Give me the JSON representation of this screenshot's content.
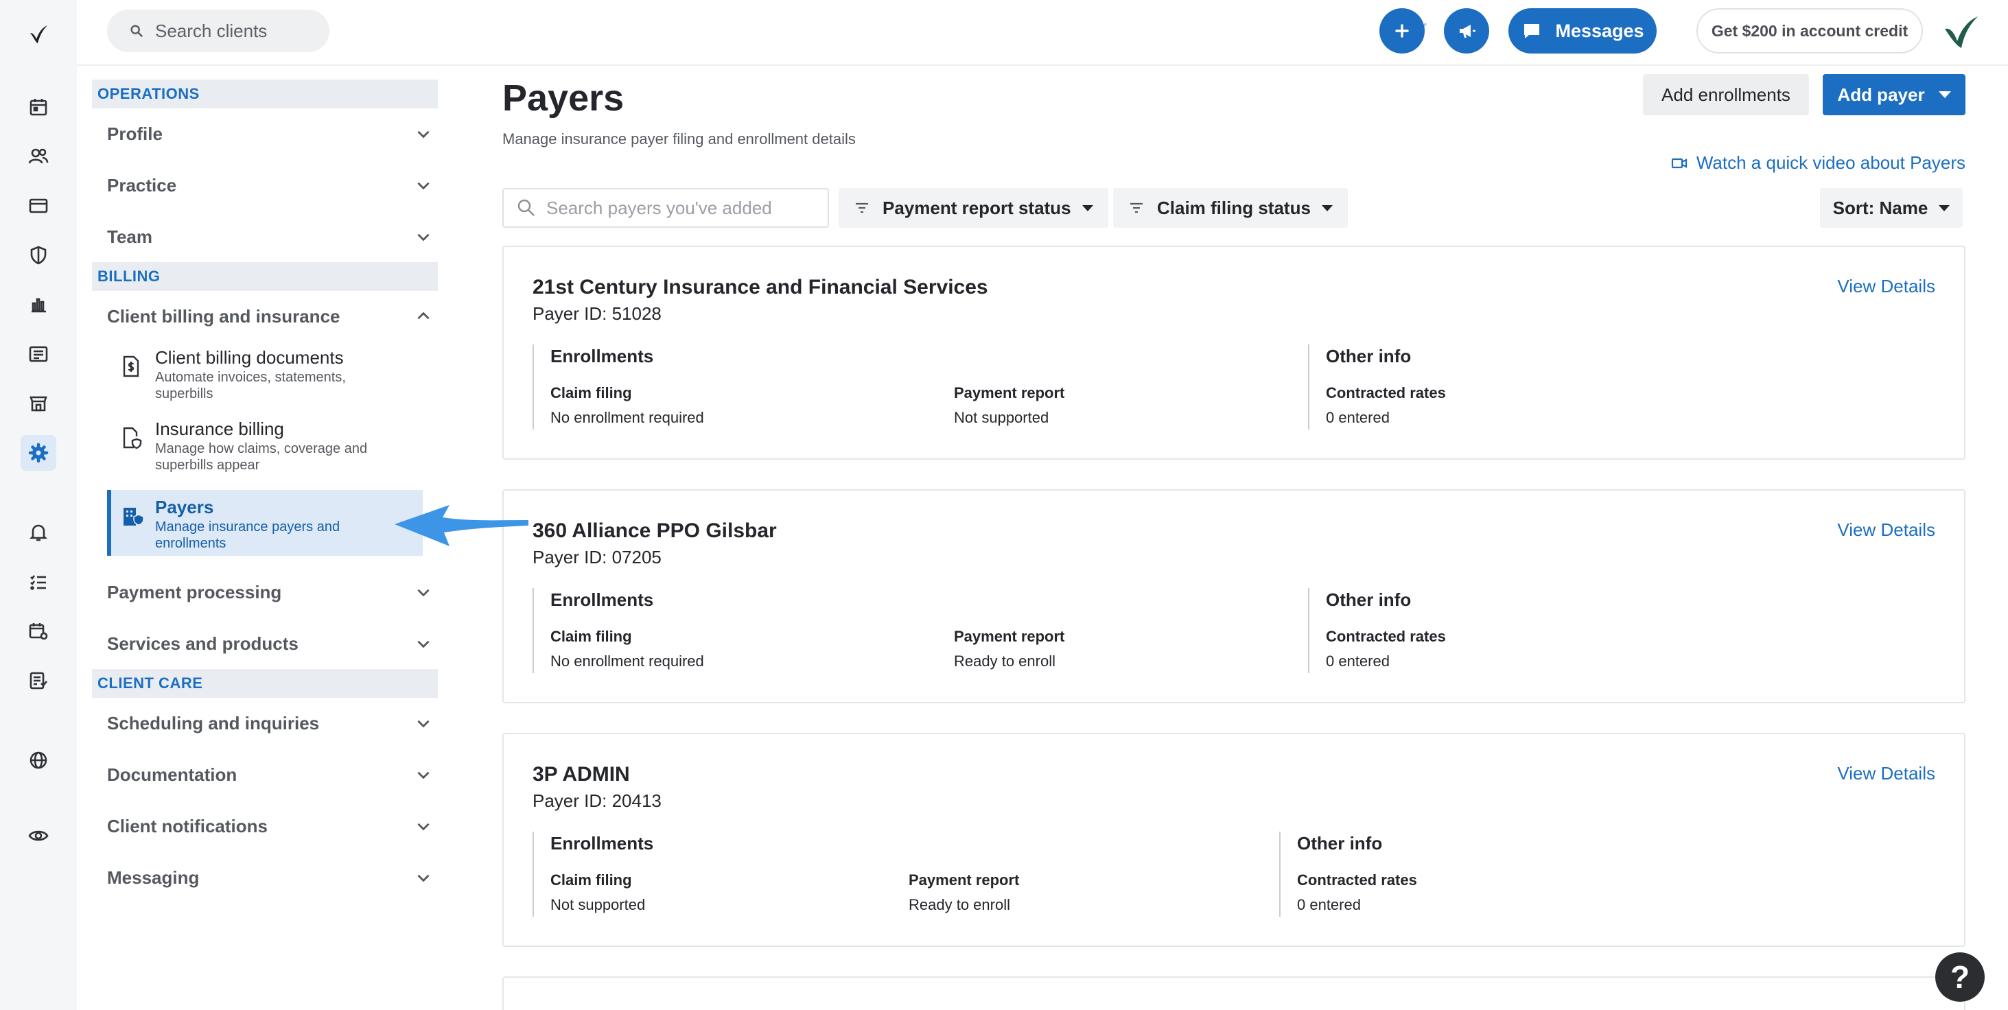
{
  "top_bar": {
    "client_search_placeholder": "Search clients",
    "messages_label": "Messages",
    "credit_label": "Get $200 in account credit"
  },
  "sidebar": {
    "operations_heading": "OPERATIONS",
    "profile": "Profile",
    "practice": "Practice",
    "team": "Team",
    "billing_heading": "BILLING",
    "client_billing_insurance": "Client billing and insurance",
    "sub_items": [
      {
        "title": "Client billing documents",
        "desc": "Automate invoices, statements, superbills"
      },
      {
        "title": "Insurance billing",
        "desc": "Manage how claims, coverage and superbills appear"
      },
      {
        "title": "Payers",
        "desc": "Manage insurance payers and enrollments"
      }
    ],
    "payment_processing": "Payment processing",
    "services_products": "Services and products",
    "client_care_heading": "CLIENT CARE",
    "scheduling_inquiries": "Scheduling and inquiries",
    "documentation": "Documentation",
    "client_notifications": "Client notifications",
    "messaging": "Messaging"
  },
  "main": {
    "title": "Payers",
    "subtitle": "Manage insurance payer filing and enrollment details",
    "add_enrollments_label": "Add enrollments",
    "add_payer_label": "Add payer",
    "video_link": "Watch a quick video about Payers",
    "payer_search_placeholder": "Search payers you've added",
    "filter_payment_report": "Payment report status",
    "filter_claim_filing": "Claim filing status",
    "sort_label": "Sort: Name"
  },
  "card_labels": {
    "enrollments": "Enrollments",
    "other_info": "Other info",
    "claim_filing": "Claim filing",
    "payment_report": "Payment report",
    "contracted_rates": "Contracted rates",
    "view_details": "View Details"
  },
  "payers": [
    {
      "name": "21st Century Insurance and Financial Services",
      "payer_id": "Payer ID: 51028",
      "claim_filing": "No enrollment required",
      "payment_report": "Not supported",
      "contracted_rates": "0 entered"
    },
    {
      "name": "360 Alliance PPO Gilsbar",
      "payer_id": "Payer ID: 07205",
      "claim_filing": "No enrollment required",
      "payment_report": "Ready to enroll",
      "contracted_rates": "0 entered"
    },
    {
      "name": "3P ADMIN",
      "payer_id": "Payer ID: 20413",
      "claim_filing": "Not supported",
      "payment_report": "Ready to enroll",
      "contracted_rates": "0 entered"
    }
  ],
  "help_label": "?",
  "colors": {
    "accent": "#1b6ec2",
    "active_bg": "#dde9f6",
    "arrow": "#3d95e8"
  }
}
